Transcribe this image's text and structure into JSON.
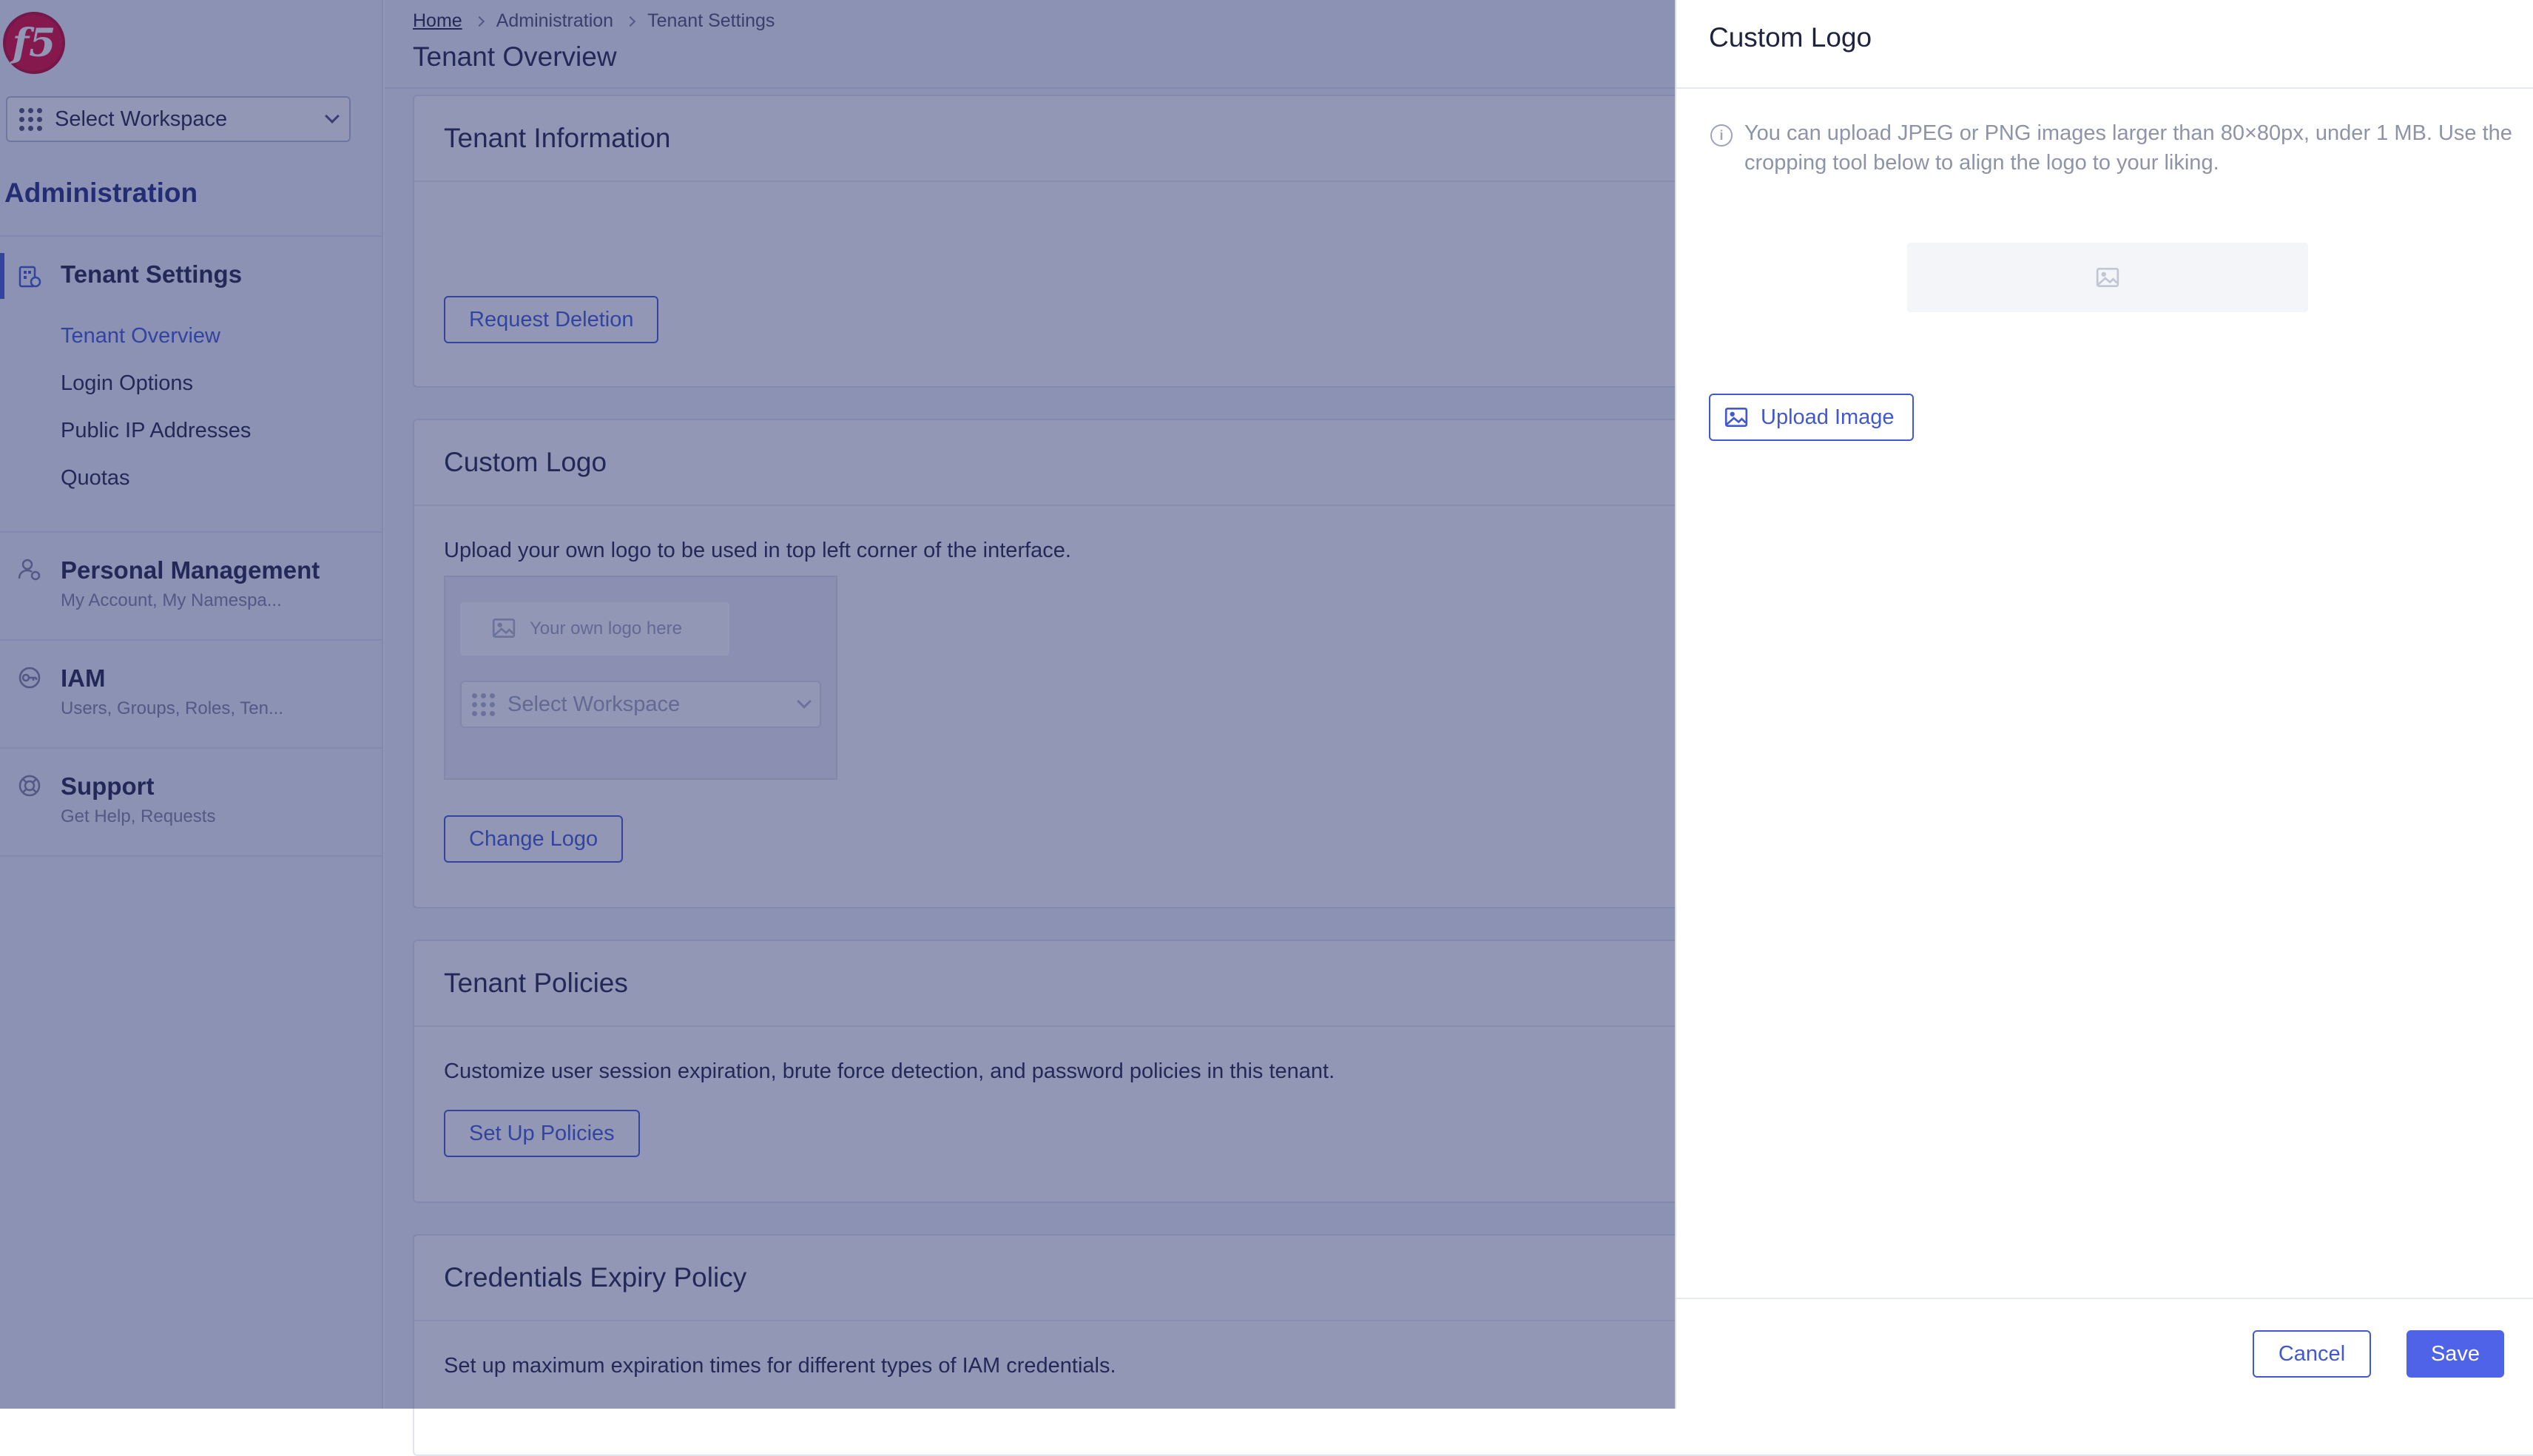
{
  "sidebar": {
    "workspace_select": "Select Workspace",
    "section_title": "Administration",
    "groups": [
      {
        "title": "Tenant Settings",
        "icon": "tenant-settings-icon"
      },
      {
        "title": "Personal Management",
        "subtitle": "My Account, My Namespa...",
        "icon": "person-gear-icon"
      },
      {
        "title": "IAM",
        "subtitle": "Users, Groups, Roles, Ten...",
        "icon": "key-icon"
      },
      {
        "title": "Support",
        "subtitle": "Get Help, Requests",
        "icon": "lifebuoy-icon"
      }
    ],
    "tenant_items": [
      "Tenant Overview",
      "Login Options",
      "Public IP Addresses",
      "Quotas"
    ]
  },
  "breadcrumb": [
    "Home",
    "Administration",
    "Tenant Settings"
  ],
  "page_title": "Tenant Overview",
  "cards": {
    "tenant_info": {
      "title": "Tenant Information",
      "button": "Request Deletion"
    },
    "custom_logo": {
      "title": "Custom Logo",
      "description": "Upload your own logo to be used in top left corner of the interface.",
      "preview_logo_text": "Your own logo here",
      "preview_workspace": "Select Workspace",
      "button": "Change Logo"
    },
    "tenant_policies": {
      "title": "Tenant Policies",
      "description": "Customize user session expiration, brute force detection, and password policies in this tenant.",
      "button": "Set Up Policies"
    },
    "credentials": {
      "title": "Credentials Expiry Policy",
      "description": "Set up maximum expiration times for different types of IAM credentials."
    }
  },
  "drawer": {
    "title": "Custom Logo",
    "info": "You can upload JPEG or PNG images larger than 80×80px, under 1 MB. Use the cropping tool below to align the logo to your liking.",
    "upload_button": "Upload Image",
    "cancel_button": "Cancel",
    "save_button": "Save"
  },
  "colors": {
    "accent": "#4158d0",
    "primary_button": "#4f63e8",
    "brand_red": "#e4002b"
  }
}
